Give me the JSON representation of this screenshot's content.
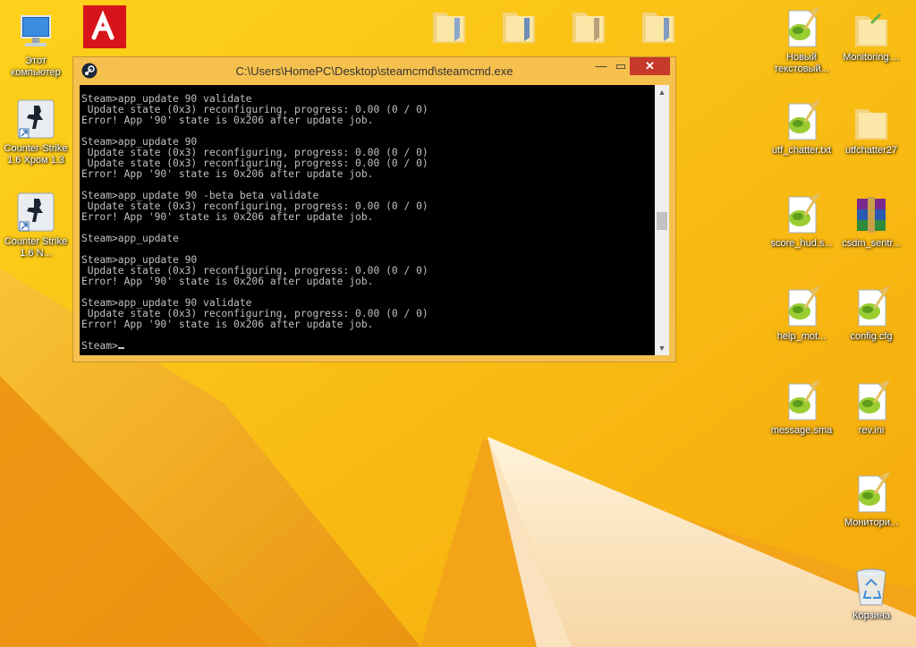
{
  "desktop": {
    "left_icons": [
      {
        "label": "Этот компьютер",
        "icon": "computer-icon"
      },
      {
        "label": "Counter-Strike 1.6 Хром 1.3",
        "icon": "counter-strike-icon"
      },
      {
        "label": "Counter Strike 1.6 N...",
        "icon": "counter-strike-icon"
      }
    ],
    "right_icons": [
      {
        "label": "Новый текстовый...",
        "icon": "notepadpp-file-icon"
      },
      {
        "label": "Monitoring....",
        "icon": "folder-icon"
      },
      {
        "label": "utf_chatter.txt",
        "icon": "notepadpp-file-icon"
      },
      {
        "label": "utfchatter27",
        "icon": "folder-icon"
      },
      {
        "label": "score_hud.s...",
        "icon": "notepadpp-file-icon"
      },
      {
        "label": "csdm_sentr...",
        "icon": "winrar-archive-icon"
      },
      {
        "label": "help_mot...",
        "icon": "notepadpp-file-icon"
      },
      {
        "label": "config.cfg",
        "icon": "notepadpp-file-icon"
      },
      {
        "label": "message.sma",
        "icon": "notepadpp-file-icon"
      },
      {
        "label": "rev.ini",
        "icon": "notepadpp-file-icon"
      },
      {
        "label": "Монитори...",
        "icon": "notepadpp-file-icon"
      },
      {
        "label": "Корзина",
        "icon": "recycle-bin-icon"
      }
    ]
  },
  "console": {
    "title": "C:\\Users\\HomePC\\Desktop\\steamcmd\\steamcmd.exe",
    "minimize_label": "—",
    "maximize_label": "▭",
    "close_label": "✕",
    "lines": [
      "Steam>app_update 90 validate",
      " Update state (0x3) reconfiguring, progress: 0.00 (0 / 0)",
      "Error! App '90' state is 0x206 after update job.",
      "",
      "Steam>app_update 90",
      " Update state (0x3) reconfiguring, progress: 0.00 (0 / 0)",
      " Update state (0x3) reconfiguring, progress: 0.00 (0 / 0)",
      "Error! App '90' state is 0x206 after update job.",
      "",
      "Steam>app_update 90 -beta beta validate",
      " Update state (0x3) reconfiguring, progress: 0.00 (0 / 0)",
      "Error! App '90' state is 0x206 after update job.",
      "",
      "Steam>app_update",
      "",
      "Steam>app_update 90",
      " Update state (0x3) reconfiguring, progress: 0.00 (0 / 0)",
      "Error! App '90' state is 0x206 after update job.",
      "",
      "Steam>app_update 90 validate",
      " Update state (0x3) reconfiguring, progress: 0.00 (0 / 0)",
      "Error! App '90' state is 0x206 after update job.",
      ""
    ],
    "prompt": "Steam>"
  },
  "colors": {
    "wallpaper": "#f7b80f",
    "console_bg": "#000000",
    "console_text": "#c0c0c0",
    "close_button": "#c7392b"
  }
}
